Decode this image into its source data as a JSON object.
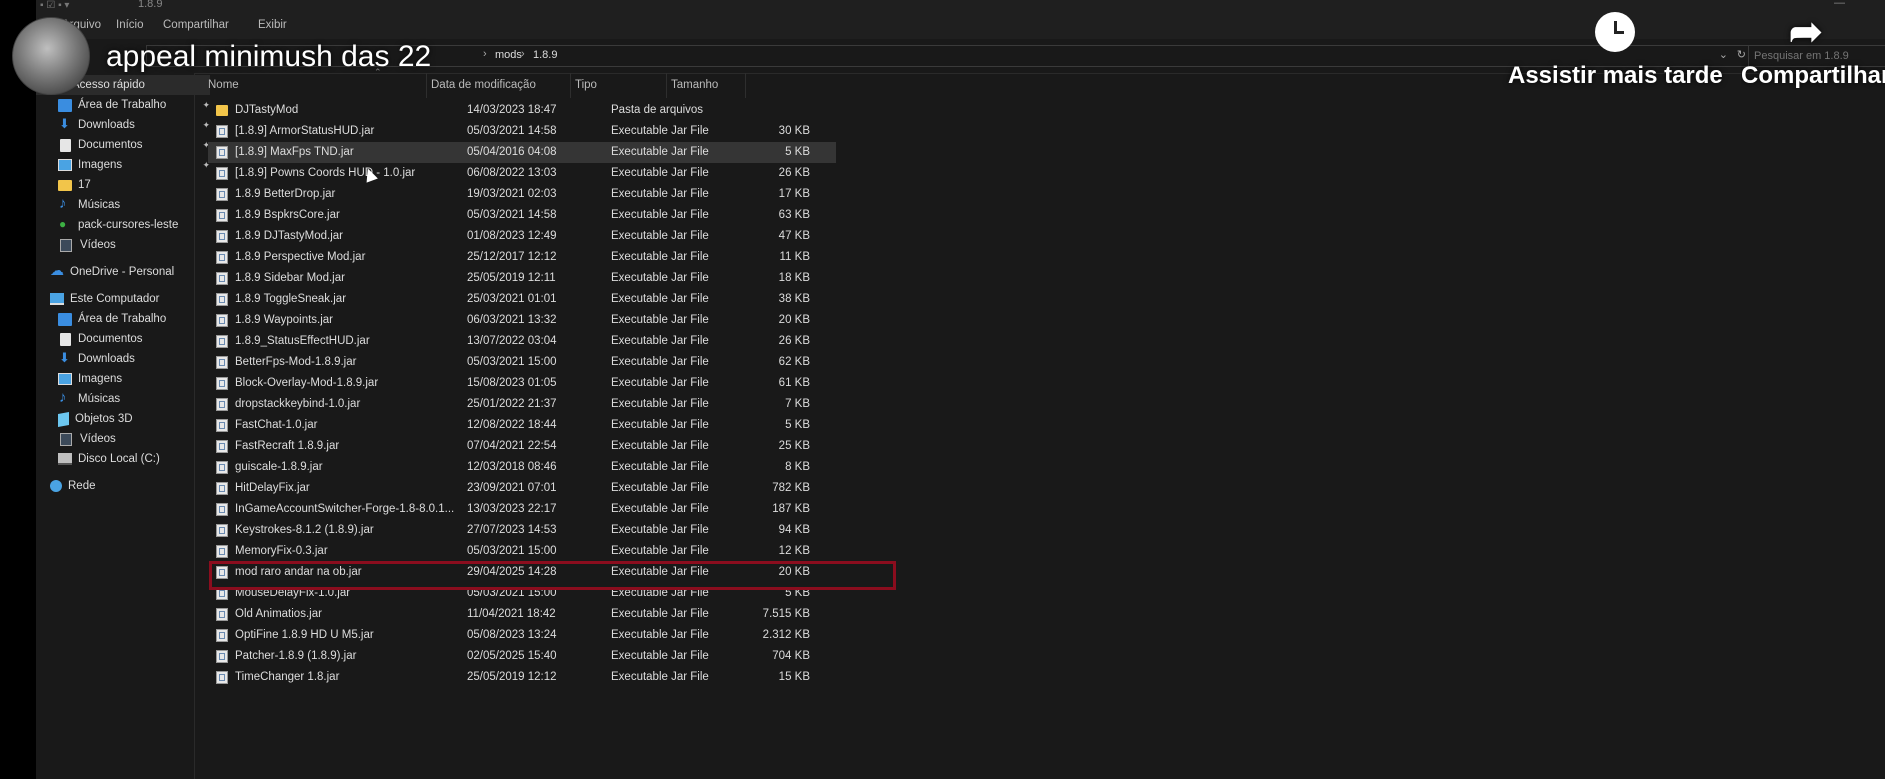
{
  "window": {
    "path_fragment": "1.8.9"
  },
  "ribbon": {
    "tabs": [
      "Arquivo",
      "Início",
      "Compartilhar",
      "Exibir"
    ]
  },
  "address": {
    "crumbs": [
      "mods",
      "1.8.9"
    ],
    "refresh_icon": "refresh-icon"
  },
  "search": {
    "placeholder": "Pesquisar em 1.8.9"
  },
  "nav": {
    "quick_access": "Acesso rápido",
    "quick_items": [
      {
        "label": "Área de Trabalho",
        "icon": "desktop-icon",
        "pinned": true
      },
      {
        "label": "Downloads",
        "icon": "download-icon",
        "pinned": true
      },
      {
        "label": "Documentos",
        "icon": "document-icon",
        "pinned": true
      },
      {
        "label": "Imagens",
        "icon": "image-icon",
        "pinned": true
      },
      {
        "label": "17",
        "icon": "folder-icon",
        "pinned": false
      },
      {
        "label": "Músicas",
        "icon": "music-icon",
        "pinned": false
      },
      {
        "label": "pack-cursores-leste",
        "icon": "pack-icon",
        "pinned": false
      },
      {
        "label": "Vídeos",
        "icon": "video-icon",
        "pinned": false
      }
    ],
    "onedrive": "OneDrive - Personal",
    "this_pc": "Este Computador",
    "pc_items": [
      {
        "label": "Área de Trabalho",
        "icon": "desktop-icon"
      },
      {
        "label": "Documentos",
        "icon": "document-icon"
      },
      {
        "label": "Downloads",
        "icon": "download-icon"
      },
      {
        "label": "Imagens",
        "icon": "image-icon"
      },
      {
        "label": "Músicas",
        "icon": "music-icon"
      },
      {
        "label": "Objetos 3D",
        "icon": "cube-icon"
      },
      {
        "label": "Vídeos",
        "icon": "video-icon"
      },
      {
        "label": "Disco Local (C:)",
        "icon": "disk-icon"
      }
    ],
    "network": "Rede"
  },
  "columns": {
    "name": "Nome",
    "date": "Data de modificação",
    "type": "Tipo",
    "size": "Tamanho"
  },
  "files": [
    {
      "name": "DJTastyMod",
      "date": "14/03/2023 18:47",
      "type": "Pasta de arquivos",
      "size": "",
      "kind": "folder"
    },
    {
      "name": "[1.8.9] ArmorStatusHUD.jar",
      "date": "05/03/2021 14:58",
      "type": "Executable Jar File",
      "size": "30 KB",
      "kind": "jar"
    },
    {
      "name": "[1.8.9] MaxFps TND.jar",
      "date": "05/04/2016 04:08",
      "type": "Executable Jar File",
      "size": "5 KB",
      "kind": "jar",
      "selected": true
    },
    {
      "name": "[1.8.9] Powns Coords HUD - 1.0.jar",
      "date": "06/08/2022 13:03",
      "type": "Executable Jar File",
      "size": "26 KB",
      "kind": "jar"
    },
    {
      "name": "1.8.9 BetterDrop.jar",
      "date": "19/03/2021 02:03",
      "type": "Executable Jar File",
      "size": "17 KB",
      "kind": "jar"
    },
    {
      "name": "1.8.9 BspkrsCore.jar",
      "date": "05/03/2021 14:58",
      "type": "Executable Jar File",
      "size": "63 KB",
      "kind": "jar"
    },
    {
      "name": "1.8.9 DJTastyMod.jar",
      "date": "01/08/2023 12:49",
      "type": "Executable Jar File",
      "size": "47 KB",
      "kind": "jar"
    },
    {
      "name": "1.8.9 Perspective Mod.jar",
      "date": "25/12/2017 12:12",
      "type": "Executable Jar File",
      "size": "11 KB",
      "kind": "jar"
    },
    {
      "name": "1.8.9 Sidebar Mod.jar",
      "date": "25/05/2019 12:11",
      "type": "Executable Jar File",
      "size": "18 KB",
      "kind": "jar"
    },
    {
      "name": "1.8.9 ToggleSneak.jar",
      "date": "25/03/2021 01:01",
      "type": "Executable Jar File",
      "size": "38 KB",
      "kind": "jar"
    },
    {
      "name": "1.8.9 Waypoints.jar",
      "date": "06/03/2021 13:32",
      "type": "Executable Jar File",
      "size": "20 KB",
      "kind": "jar"
    },
    {
      "name": "1.8.9_StatusEffectHUD.jar",
      "date": "13/07/2022 03:04",
      "type": "Executable Jar File",
      "size": "26 KB",
      "kind": "jar"
    },
    {
      "name": "BetterFps-Mod-1.8.9.jar",
      "date": "05/03/2021 15:00",
      "type": "Executable Jar File",
      "size": "62 KB",
      "kind": "jar"
    },
    {
      "name": "Block-Overlay-Mod-1.8.9.jar",
      "date": "15/08/2023 01:05",
      "type": "Executable Jar File",
      "size": "61 KB",
      "kind": "jar"
    },
    {
      "name": "dropstackkeybind-1.0.jar",
      "date": "25/01/2022 21:37",
      "type": "Executable Jar File",
      "size": "7 KB",
      "kind": "jar"
    },
    {
      "name": "FastChat-1.0.jar",
      "date": "12/08/2022 18:44",
      "type": "Executable Jar File",
      "size": "5 KB",
      "kind": "jar"
    },
    {
      "name": "FastRecraft 1.8.9.jar",
      "date": "07/04/2021 22:54",
      "type": "Executable Jar File",
      "size": "25 KB",
      "kind": "jar"
    },
    {
      "name": "guiscale-1.8.9.jar",
      "date": "12/03/2018 08:46",
      "type": "Executable Jar File",
      "size": "8 KB",
      "kind": "jar"
    },
    {
      "name": "HitDelayFix.jar",
      "date": "23/09/2021 07:01",
      "type": "Executable Jar File",
      "size": "782 KB",
      "kind": "jar"
    },
    {
      "name": "InGameAccountSwitcher-Forge-1.8-8.0.1...",
      "date": "13/03/2023 22:17",
      "type": "Executable Jar File",
      "size": "187 KB",
      "kind": "jar"
    },
    {
      "name": "Keystrokes-8.1.2 (1.8.9).jar",
      "date": "27/07/2023 14:53",
      "type": "Executable Jar File",
      "size": "94 KB",
      "kind": "jar"
    },
    {
      "name": "MemoryFix-0.3.jar",
      "date": "05/03/2021 15:00",
      "type": "Executable Jar File",
      "size": "12 KB",
      "kind": "jar"
    },
    {
      "name": "mod raro andar na ob.jar",
      "date": "29/04/2025 14:28",
      "type": "Executable Jar File",
      "size": "20 KB",
      "kind": "jar",
      "highlighted": true
    },
    {
      "name": "MouseDelayFix-1.0.jar",
      "date": "05/03/2021 15:00",
      "type": "Executable Jar File",
      "size": "5 KB",
      "kind": "jar"
    },
    {
      "name": "Old Animatios.jar",
      "date": "11/04/2021 18:42",
      "type": "Executable Jar File",
      "size": "7.515 KB",
      "kind": "jar"
    },
    {
      "name": "OptiFine 1.8.9 HD U M5.jar",
      "date": "05/08/2023 13:24",
      "type": "Executable Jar File",
      "size": "2.312 KB",
      "kind": "jar"
    },
    {
      "name": "Patcher-1.8.9 (1.8.9).jar",
      "date": "02/05/2025 15:40",
      "type": "Executable Jar File",
      "size": "704 KB",
      "kind": "jar"
    },
    {
      "name": "TimeChanger 1.8.jar",
      "date": "25/05/2019 12:12",
      "type": "Executable Jar File",
      "size": "15 KB",
      "kind": "jar"
    }
  ],
  "overlay": {
    "video_title": "appeal minimush das 22",
    "watch_later": "Assistir mais tarde",
    "share": "Compartilhar",
    "highlight_color": "#8b0d1e"
  }
}
